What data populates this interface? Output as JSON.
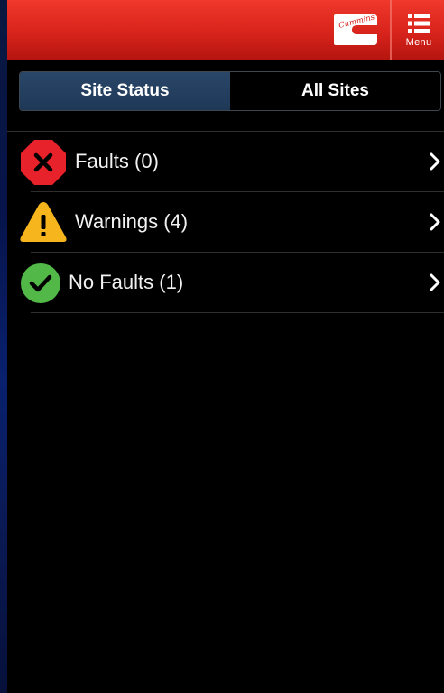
{
  "header": {
    "logo_text": "Cummins",
    "menu_label": "Menu",
    "colors": {
      "bar_top": "#f0382c",
      "bar_bottom": "#b5150f"
    }
  },
  "tabs": [
    {
      "label": "Site Status",
      "active": true
    },
    {
      "label": "All Sites",
      "active": false
    }
  ],
  "status_list": [
    {
      "icon": "fault-octagon-icon",
      "label": "Faults (0)",
      "color": "#e8222a"
    },
    {
      "icon": "warning-triangle-icon",
      "label": "Warnings (4)",
      "color": "#f7b51d"
    },
    {
      "icon": "check-circle-icon",
      "label": "No Faults (1)",
      "color": "#52b848"
    }
  ]
}
